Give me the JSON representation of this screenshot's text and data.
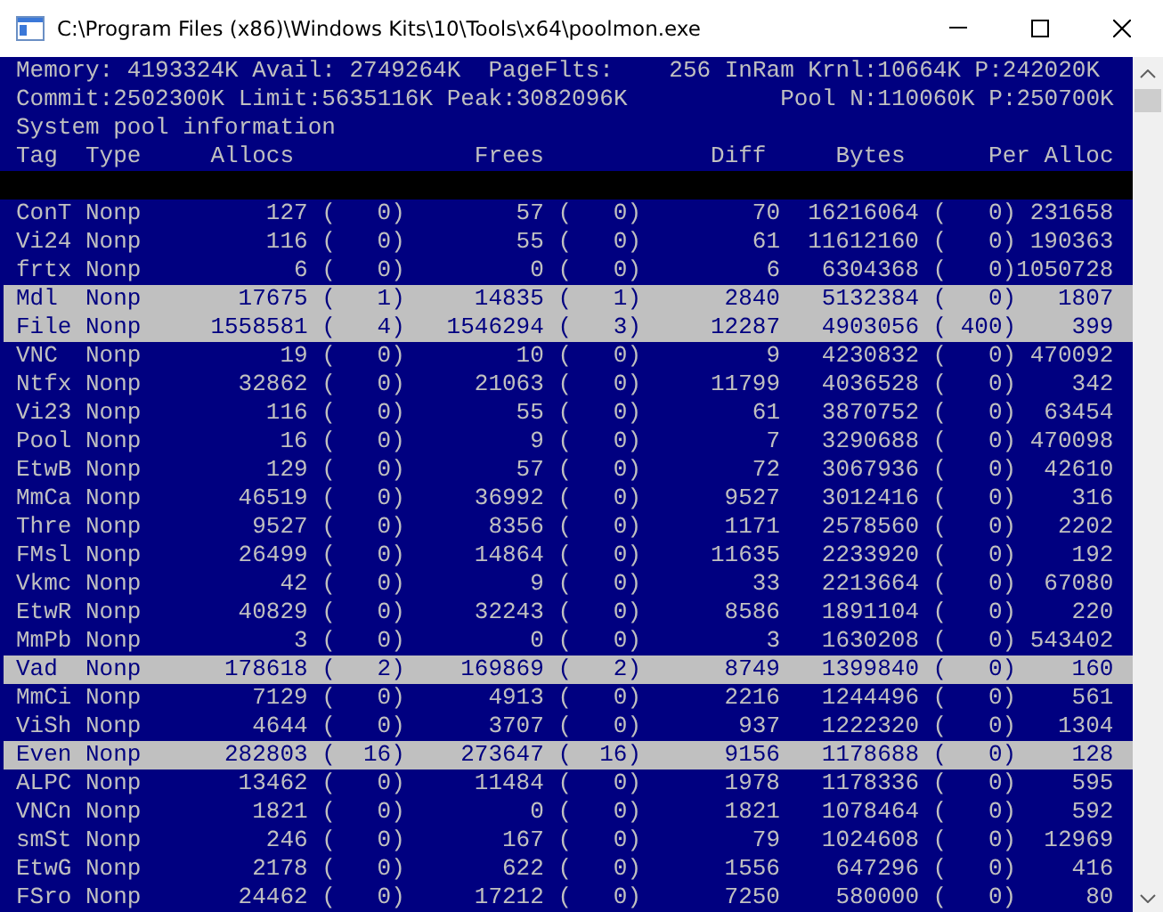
{
  "window": {
    "title": "C:\\Program Files (x86)\\Windows Kits\\10\\Tools\\x64\\poolmon.exe"
  },
  "stats_lines": [
    "Memory: 4193324K Avail: 2749264K  PageFlts:    256 InRam Krnl:10664K P:242020K",
    "Commit:2502300K Limit:5635116K Peak:3082096K           Pool N:110060K P:250700K"
  ],
  "section_title": "System pool information",
  "columns": [
    "Tag",
    "Type",
    "Allocs",
    "Frees",
    "Diff",
    "Bytes",
    "Per Alloc"
  ],
  "rows": [
    {
      "tag": "ConT",
      "type": "Nonp",
      "allocs": "127",
      "allocs_delta": "(   0)",
      "frees": "57",
      "frees_delta": "(   0)",
      "diff": "70",
      "bytes": "16216064",
      "bytes_delta": "(   0)",
      "per_alloc": "231658",
      "highlighted": false
    },
    {
      "tag": "Vi24",
      "type": "Nonp",
      "allocs": "116",
      "allocs_delta": "(   0)",
      "frees": "55",
      "frees_delta": "(   0)",
      "diff": "61",
      "bytes": "11612160",
      "bytes_delta": "(   0)",
      "per_alloc": "190363",
      "highlighted": false
    },
    {
      "tag": "frtx",
      "type": "Nonp",
      "allocs": "6",
      "allocs_delta": "(   0)",
      "frees": "0",
      "frees_delta": "(   0)",
      "diff": "6",
      "bytes": "6304368",
      "bytes_delta": "(   0)",
      "per_alloc": "1050728",
      "highlighted": false
    },
    {
      "tag": "Mdl",
      "type": "Nonp",
      "allocs": "17675",
      "allocs_delta": "(   1)",
      "frees": "14835",
      "frees_delta": "(   1)",
      "diff": "2840",
      "bytes": "5132384",
      "bytes_delta": "(   0)",
      "per_alloc": "1807",
      "highlighted": true
    },
    {
      "tag": "File",
      "type": "Nonp",
      "allocs": "1558581",
      "allocs_delta": "(   4)",
      "frees": "1546294",
      "frees_delta": "(   3)",
      "diff": "12287",
      "bytes": "4903056",
      "bytes_delta": "( 400)",
      "per_alloc": "399",
      "highlighted": true
    },
    {
      "tag": "VNC",
      "type": "Nonp",
      "allocs": "19",
      "allocs_delta": "(   0)",
      "frees": "10",
      "frees_delta": "(   0)",
      "diff": "9",
      "bytes": "4230832",
      "bytes_delta": "(   0)",
      "per_alloc": "470092",
      "highlighted": false
    },
    {
      "tag": "Ntfx",
      "type": "Nonp",
      "allocs": "32862",
      "allocs_delta": "(   0)",
      "frees": "21063",
      "frees_delta": "(   0)",
      "diff": "11799",
      "bytes": "4036528",
      "bytes_delta": "(   0)",
      "per_alloc": "342",
      "highlighted": false
    },
    {
      "tag": "Vi23",
      "type": "Nonp",
      "allocs": "116",
      "allocs_delta": "(   0)",
      "frees": "55",
      "frees_delta": "(   0)",
      "diff": "61",
      "bytes": "3870752",
      "bytes_delta": "(   0)",
      "per_alloc": "63454",
      "highlighted": false
    },
    {
      "tag": "Pool",
      "type": "Nonp",
      "allocs": "16",
      "allocs_delta": "(   0)",
      "frees": "9",
      "frees_delta": "(   0)",
      "diff": "7",
      "bytes": "3290688",
      "bytes_delta": "(   0)",
      "per_alloc": "470098",
      "highlighted": false
    },
    {
      "tag": "EtwB",
      "type": "Nonp",
      "allocs": "129",
      "allocs_delta": "(   0)",
      "frees": "57",
      "frees_delta": "(   0)",
      "diff": "72",
      "bytes": "3067936",
      "bytes_delta": "(   0)",
      "per_alloc": "42610",
      "highlighted": false
    },
    {
      "tag": "MmCa",
      "type": "Nonp",
      "allocs": "46519",
      "allocs_delta": "(   0)",
      "frees": "36992",
      "frees_delta": "(   0)",
      "diff": "9527",
      "bytes": "3012416",
      "bytes_delta": "(   0)",
      "per_alloc": "316",
      "highlighted": false
    },
    {
      "tag": "Thre",
      "type": "Nonp",
      "allocs": "9527",
      "allocs_delta": "(   0)",
      "frees": "8356",
      "frees_delta": "(   0)",
      "diff": "1171",
      "bytes": "2578560",
      "bytes_delta": "(   0)",
      "per_alloc": "2202",
      "highlighted": false
    },
    {
      "tag": "FMsl",
      "type": "Nonp",
      "allocs": "26499",
      "allocs_delta": "(   0)",
      "frees": "14864",
      "frees_delta": "(   0)",
      "diff": "11635",
      "bytes": "2233920",
      "bytes_delta": "(   0)",
      "per_alloc": "192",
      "highlighted": false
    },
    {
      "tag": "Vkmc",
      "type": "Nonp",
      "allocs": "42",
      "allocs_delta": "(   0)",
      "frees": "9",
      "frees_delta": "(   0)",
      "diff": "33",
      "bytes": "2213664",
      "bytes_delta": "(   0)",
      "per_alloc": "67080",
      "highlighted": false
    },
    {
      "tag": "EtwR",
      "type": "Nonp",
      "allocs": "40829",
      "allocs_delta": "(   0)",
      "frees": "32243",
      "frees_delta": "(   0)",
      "diff": "8586",
      "bytes": "1891104",
      "bytes_delta": "(   0)",
      "per_alloc": "220",
      "highlighted": false
    },
    {
      "tag": "MmPb",
      "type": "Nonp",
      "allocs": "3",
      "allocs_delta": "(   0)",
      "frees": "0",
      "frees_delta": "(   0)",
      "diff": "3",
      "bytes": "1630208",
      "bytes_delta": "(   0)",
      "per_alloc": "543402",
      "highlighted": false
    },
    {
      "tag": "Vad",
      "type": "Nonp",
      "allocs": "178618",
      "allocs_delta": "(   2)",
      "frees": "169869",
      "frees_delta": "(   2)",
      "diff": "8749",
      "bytes": "1399840",
      "bytes_delta": "(   0)",
      "per_alloc": "160",
      "highlighted": true
    },
    {
      "tag": "MmCi",
      "type": "Nonp",
      "allocs": "7129",
      "allocs_delta": "(   0)",
      "frees": "4913",
      "frees_delta": "(   0)",
      "diff": "2216",
      "bytes": "1244496",
      "bytes_delta": "(   0)",
      "per_alloc": "561",
      "highlighted": false
    },
    {
      "tag": "ViSh",
      "type": "Nonp",
      "allocs": "4644",
      "allocs_delta": "(   0)",
      "frees": "3707",
      "frees_delta": "(   0)",
      "diff": "937",
      "bytes": "1222320",
      "bytes_delta": "(   0)",
      "per_alloc": "1304",
      "highlighted": false
    },
    {
      "tag": "Even",
      "type": "Nonp",
      "allocs": "282803",
      "allocs_delta": "(  16)",
      "frees": "273647",
      "frees_delta": "(  16)",
      "diff": "9156",
      "bytes": "1178688",
      "bytes_delta": "(   0)",
      "per_alloc": "128",
      "highlighted": true
    },
    {
      "tag": "ALPC",
      "type": "Nonp",
      "allocs": "13462",
      "allocs_delta": "(   0)",
      "frees": "11484",
      "frees_delta": "(   0)",
      "diff": "1978",
      "bytes": "1178336",
      "bytes_delta": "(   0)",
      "per_alloc": "595",
      "highlighted": false
    },
    {
      "tag": "VNCn",
      "type": "Nonp",
      "allocs": "1821",
      "allocs_delta": "(   0)",
      "frees": "0",
      "frees_delta": "(   0)",
      "diff": "1821",
      "bytes": "1078464",
      "bytes_delta": "(   0)",
      "per_alloc": "592",
      "highlighted": false
    },
    {
      "tag": "smSt",
      "type": "Nonp",
      "allocs": "246",
      "allocs_delta": "(   0)",
      "frees": "167",
      "frees_delta": "(   0)",
      "diff": "79",
      "bytes": "1024608",
      "bytes_delta": "(   0)",
      "per_alloc": "12969",
      "highlighted": false
    },
    {
      "tag": "EtwG",
      "type": "Nonp",
      "allocs": "2178",
      "allocs_delta": "(   0)",
      "frees": "622",
      "frees_delta": "(   0)",
      "diff": "1556",
      "bytes": "647296",
      "bytes_delta": "(   0)",
      "per_alloc": "416",
      "highlighted": false
    },
    {
      "tag": "FSro",
      "type": "Nonp",
      "allocs": "24462",
      "allocs_delta": "(   0)",
      "frees": "17212",
      "frees_delta": "(   0)",
      "diff": "7250",
      "bytes": "580000",
      "bytes_delta": "(   0)",
      "per_alloc": "80",
      "highlighted": false
    }
  ]
}
